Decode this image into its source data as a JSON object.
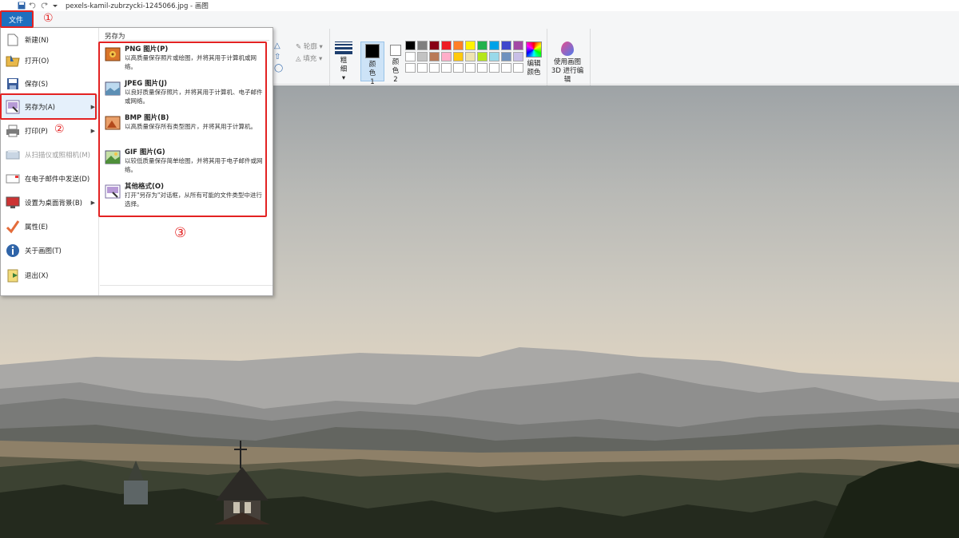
{
  "window": {
    "title": "pexels-kamil-zubrzycki-1245066.jpg - 画图"
  },
  "file_tab": {
    "label": "文件"
  },
  "menu": {
    "items": [
      {
        "label": "新建(N)",
        "icon": "new-file-icon"
      },
      {
        "label": "打开(O)",
        "icon": "open-folder-icon"
      },
      {
        "label": "保存(S)",
        "icon": "save-icon"
      },
      {
        "label": "另存为(A)",
        "icon": "save-as-icon"
      },
      {
        "label": "打印(P)",
        "icon": "print-icon"
      },
      {
        "label": "从扫描仪或照相机(M)",
        "icon": "scanner-icon"
      },
      {
        "label": "在电子邮件中发送(D)",
        "icon": "email-icon"
      },
      {
        "label": "设置为桌面背景(B)",
        "icon": "desktop-icon"
      },
      {
        "label": "属性(E)",
        "icon": "checkmark-icon"
      },
      {
        "label": "关于画图(T)",
        "icon": "info-icon"
      },
      {
        "label": "退出(X)",
        "icon": "exit-icon"
      }
    ]
  },
  "save_as": {
    "title": "另存为",
    "options": [
      {
        "title": "PNG 图片(P)",
        "desc": "以高质量保存照片或绘图，并将其用于计算机或网络。"
      },
      {
        "title": "JPEG 图片(J)",
        "desc": "以良好质量保存照片，并将其用于计算机、电子邮件或网络。"
      },
      {
        "title": "BMP 图片(B)",
        "desc": "以高质量保存所有类型图片，并将其用于计算机。"
      },
      {
        "title": "GIF 图片(G)",
        "desc": "以较低质量保存简单绘图，并将其用于电子邮件或网络。"
      },
      {
        "title": "其他格式(O)",
        "desc": "打开\"另存为\"对话框，从所有可能的文件类型中进行选择。"
      }
    ]
  },
  "ribbon": {
    "outline_label": "轮廓",
    "fill_label": "填充",
    "thickness_label": "粗细",
    "color1_label": "颜色 1",
    "color2_label": "颜色 2",
    "colors_group_label": "颜色",
    "edit_colors_label": "编辑颜色",
    "paint3d_label": "使用画图 3D 进行编辑",
    "color1": "#000000",
    "color2": "#ffffff",
    "palette": [
      "#000000",
      "#7f7f7f",
      "#880015",
      "#ed1c24",
      "#ff7f27",
      "#fff200",
      "#22b14c",
      "#00a2e8",
      "#3f48cc",
      "#a349a4",
      "#ffffff",
      "#c3c3c3",
      "#b97a57",
      "#ffaec9",
      "#ffc90e",
      "#efe4b0",
      "#b5e61d",
      "#99d9ea",
      "#7092be",
      "#c8bfe7",
      "#ffffff",
      "#ffffff",
      "#ffffff",
      "#ffffff",
      "#ffffff",
      "#ffffff",
      "#ffffff",
      "#ffffff",
      "#ffffff",
      "#ffffff"
    ]
  },
  "annotations": {
    "step1": "①",
    "step2": "②",
    "step3": "③",
    "color": "#e32222"
  }
}
